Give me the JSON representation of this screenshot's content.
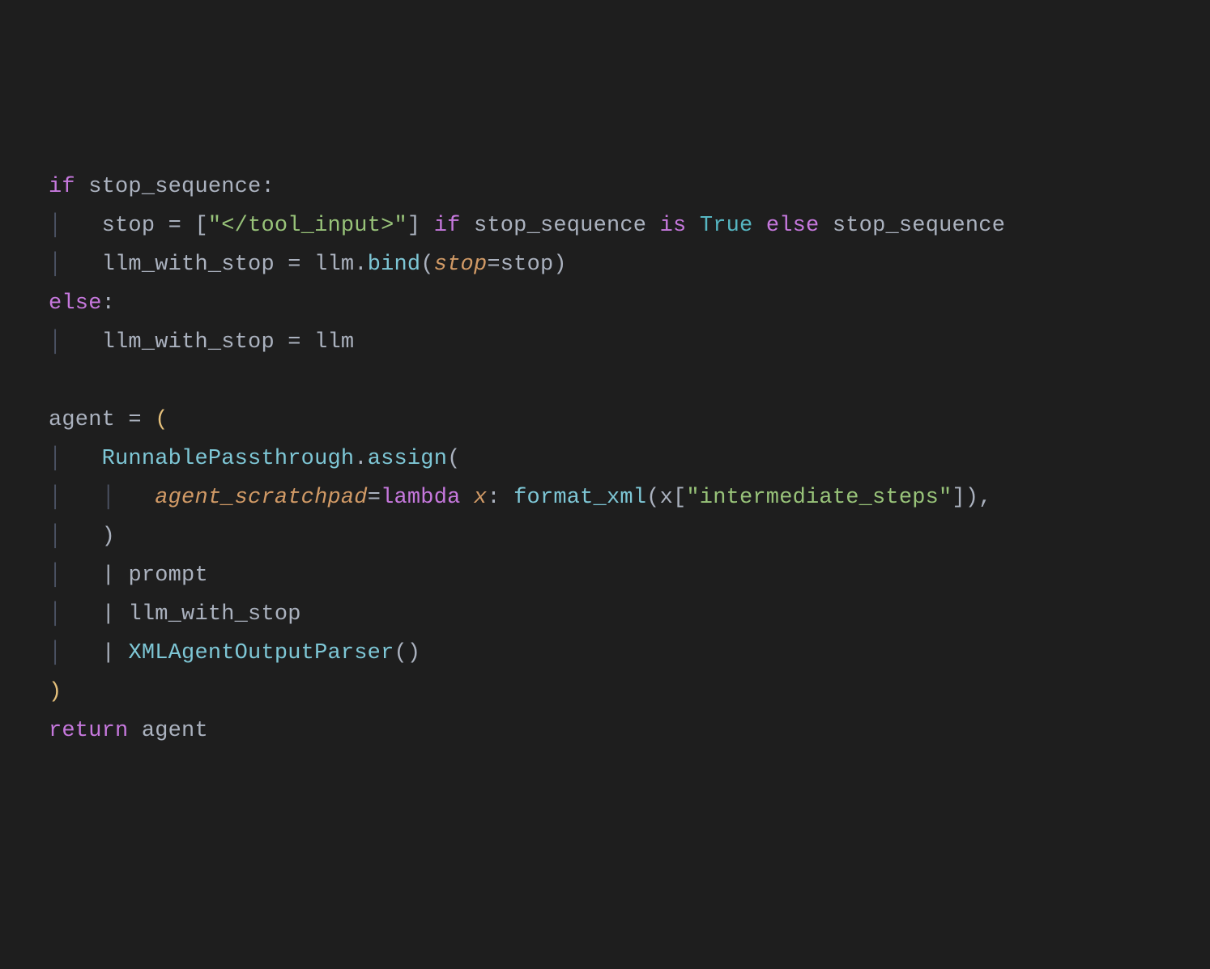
{
  "colors": {
    "background": "#1e1e1e",
    "default": "#abb2bf",
    "keyword": "#c678dd",
    "param": "#d19a66",
    "constant": "#56b6c2",
    "string": "#98c379",
    "function": "#7ec7d6",
    "paren_highlight": "#e5c07b",
    "indent_guide": "#4b5263"
  },
  "tokens": {
    "if": "if",
    "stop_sequence": "stop_sequence",
    "colon": ":",
    "stop": "stop",
    "eq": "=",
    "lbracket": "[",
    "rbracket": "]",
    "str_tool_input": "\"</tool_input>\"",
    "is": "is",
    "True": "True",
    "else": "else",
    "llm_with_stop": "llm_with_stop",
    "llm": "llm",
    "dot": ".",
    "bind": "bind",
    "lparen": "(",
    "rparen": ")",
    "agent": "agent",
    "RunnablePassthrough": "RunnablePassthrough",
    "assign": "assign",
    "agent_scratchpad": "agent_scratchpad",
    "lambda": "lambda",
    "x": "x",
    "format_xml": "format_xml",
    "str_intermediate": "\"intermediate_steps\"",
    "comma": ",",
    "pipe": "|",
    "prompt": "prompt",
    "XMLAgentOutputParser": "XMLAgentOutputParser",
    "return": "return"
  },
  "indent": {
    "one": "    ",
    "two": "        ",
    "guide1": "│   ",
    "guide2": "│   │   "
  }
}
